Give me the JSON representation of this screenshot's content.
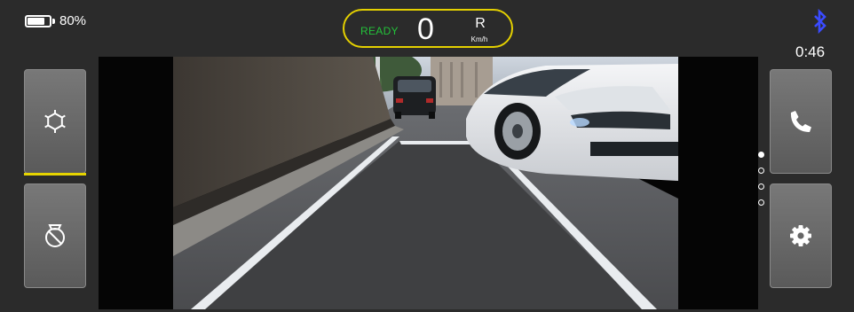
{
  "status_bar": {
    "battery_level": 0.8,
    "battery_text": "80%",
    "time": "0:46",
    "bluetooth_color": "#3a4bff"
  },
  "speed_display": {
    "status": "READY",
    "speed": "0",
    "gear": "R",
    "unit": "Km/h",
    "status_color": "#23c23a",
    "border_color": "#e4d000"
  },
  "left_buttons": [
    {
      "icon": "snowflake-icon",
      "active": true
    },
    {
      "icon": "timer-icon",
      "active": false
    }
  ],
  "right_buttons": [
    {
      "icon": "phone-icon"
    },
    {
      "icon": "gear-icon"
    }
  ],
  "page_indicator": {
    "count": 4,
    "active": 0
  },
  "colors": {
    "accent": "#e6d400",
    "panel": "#2b2b2b"
  }
}
